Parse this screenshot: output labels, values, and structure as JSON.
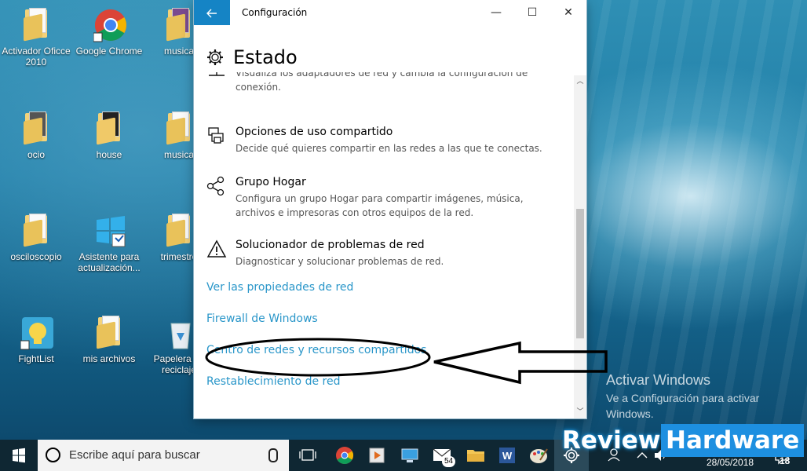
{
  "desktop": {
    "icons": [
      {
        "label": "Activador Oficce 2010"
      },
      {
        "label": "Google Chrome"
      },
      {
        "label": "musica"
      },
      {
        "label": "ocio"
      },
      {
        "label": "house"
      },
      {
        "label": "musica"
      },
      {
        "label": "osciloscopio"
      },
      {
        "label": "Asistente para actualización..."
      },
      {
        "label": "trimestre"
      },
      {
        "label": "FightList"
      },
      {
        "label": "mis archivos"
      },
      {
        "label": "Papelera de reciclaje"
      }
    ],
    "activation": {
      "heading": "Activar Windows",
      "text": "Ve a Configuración para activar Windows."
    }
  },
  "window": {
    "title": "Configuración",
    "back_icon": "back-arrow-icon",
    "controls": {
      "minimize": "—",
      "maximize": "☐",
      "close": "✕"
    },
    "page_title": "Estado",
    "items": [
      {
        "icon": "network-adapter-icon",
        "title": "",
        "desc": "Visualiza los adaptadores de red y cambia la configuración de conexión."
      },
      {
        "icon": "sharing-options-icon",
        "title": "Opciones de uso compartido",
        "desc": "Decide qué quieres compartir en las redes a las que te conectas."
      },
      {
        "icon": "homegroup-icon",
        "title": "Grupo Hogar",
        "desc": "Configura un grupo Hogar para compartir imágenes, música, archivos e impresoras con otros equipos de la red."
      },
      {
        "icon": "warning-triangle-icon",
        "title": "Solucionador de problemas de red",
        "desc": "Diagnosticar y solucionar problemas de red."
      }
    ],
    "links": [
      "Ver las propiedades de red",
      "Firewall de Windows",
      "Centro de redes y recursos compartidos",
      "Restablecimiento de red"
    ]
  },
  "taskbar": {
    "search_placeholder": "Escribe aquí para buscar",
    "mail_badge": "54",
    "date": "28/05/2018",
    "notification_count": "18"
  },
  "watermark": {
    "part1": "Review",
    "part2": "Hardware"
  },
  "colors": {
    "accent": "#1584c5",
    "link": "#2996c9",
    "taskbar": "#0f2733"
  }
}
